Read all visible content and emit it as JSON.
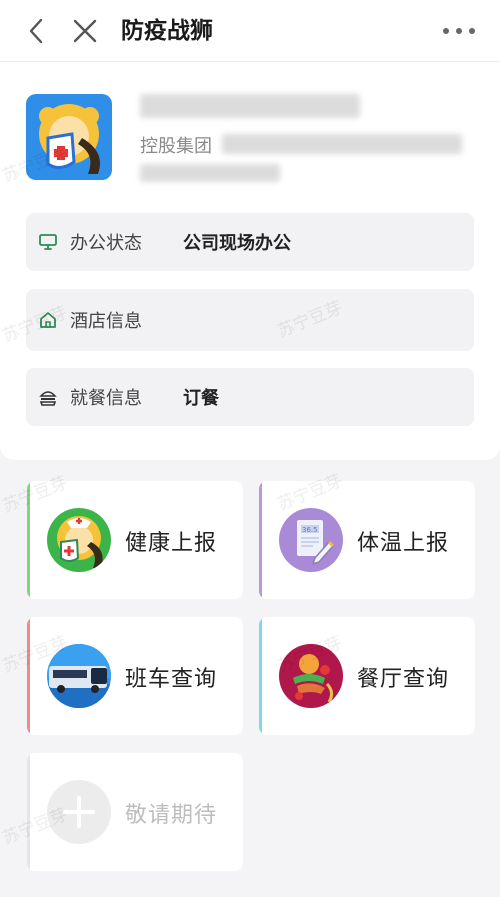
{
  "header": {
    "title": "防疫战狮"
  },
  "profile": {
    "org_prefix": "控股集团"
  },
  "info_rows": [
    {
      "label": "办公状态",
      "value": "公司现场办公",
      "icon": "monitor-icon"
    },
    {
      "label": "酒店信息",
      "value": "",
      "icon": "home-icon"
    },
    {
      "label": "就餐信息",
      "value": "订餐",
      "icon": "burger-icon"
    }
  ],
  "tiles": [
    {
      "label": "健康上报",
      "icon": "health-mascot-icon",
      "accent": "#7ed67e"
    },
    {
      "label": "体温上报",
      "icon": "temperature-form-icon",
      "accent": "#b99ad8"
    },
    {
      "label": "班车查询",
      "icon": "shuttle-bus-icon",
      "accent": "#f08a8a"
    },
    {
      "label": "餐厅查询",
      "icon": "restaurant-food-icon",
      "accent": "#7fd8e8"
    },
    {
      "label": "敬请期待",
      "icon": "plus-icon",
      "accent": "#e6e6e6"
    }
  ],
  "watermark_text": "苏宁豆芽",
  "colors": {
    "background": "#f4f4f6",
    "card": "#ffffff",
    "row": "#f2f2f4",
    "avatar_bg": "#2f8fe8"
  }
}
